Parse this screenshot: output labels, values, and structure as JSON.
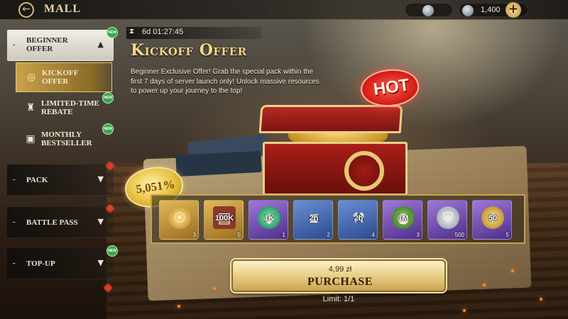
{
  "header": {
    "title": "MALL",
    "resources": [
      {
        "icon": "silver-coin-icon",
        "value": ""
      },
      {
        "icon": "crystal-icon",
        "value": "1,400"
      }
    ]
  },
  "sidebar": {
    "categories": [
      {
        "label_line1": "BEGINNER",
        "label_line2": "OFFER",
        "new": "NEW",
        "expanded": true
      },
      {
        "label": "PACK"
      },
      {
        "label": "BATTLE PASS"
      },
      {
        "label": "TOP-UP",
        "new": "NEW"
      }
    ],
    "sub_items": [
      {
        "label_line1": "KICKOFF",
        "label_line2": "OFFER",
        "icon": "coin-icon",
        "active": true
      },
      {
        "label_line1": "LIMITED-TIME",
        "label_line2": "REBATE",
        "icon": "hat-icon",
        "new": "NEW"
      },
      {
        "label_line1": "MONTHLY",
        "label_line2": "BESTSELLER",
        "icon": "gift-box-icon",
        "new": "NEW"
      }
    ]
  },
  "offer": {
    "timer": "6d 01:27:45",
    "title": "Kickoff Offer",
    "description": "Beginner Exclusive Offer! Grab the special pack within the first 7 days of server launch only! Unlock massive resources to power up your journey to the top!",
    "hot_label": "HOT",
    "value_percent": "5,051%",
    "price": "4,99 zł",
    "purchase_label": "PURCHASE",
    "limit": "Limit: 1/1"
  },
  "rewards": [
    {
      "icon": "gold-medal-icon",
      "amount": "",
      "qty": "3",
      "rarity": "gold"
    },
    {
      "icon": "resource-crate-icon",
      "amount": "100K",
      "qty": "5",
      "rarity": "gold"
    },
    {
      "icon": "emerald-icon",
      "amount": "1K",
      "qty": "1",
      "rarity": "purple"
    },
    {
      "icon": "speedup-hourglass-icon",
      "amount": "2h",
      "qty": "2",
      "rarity": "blue"
    },
    {
      "icon": "build-speedup-icon",
      "amount": "2h",
      "qty": "4",
      "rarity": "blue"
    },
    {
      "icon": "resource-pack-icon",
      "amount": "1M",
      "qty": "3",
      "rarity": "purple"
    },
    {
      "icon": "shield-token-icon",
      "amount": "",
      "qty": "500",
      "rarity": "purple"
    },
    {
      "icon": "gold-token-icon",
      "amount": "50",
      "qty": "5",
      "rarity": "purple"
    }
  ],
  "colors": {
    "accent_gold": "#d8b873",
    "new_badge": "#3aa64a",
    "alert_red": "#e23a2a",
    "hot_red": "#d21a14"
  }
}
